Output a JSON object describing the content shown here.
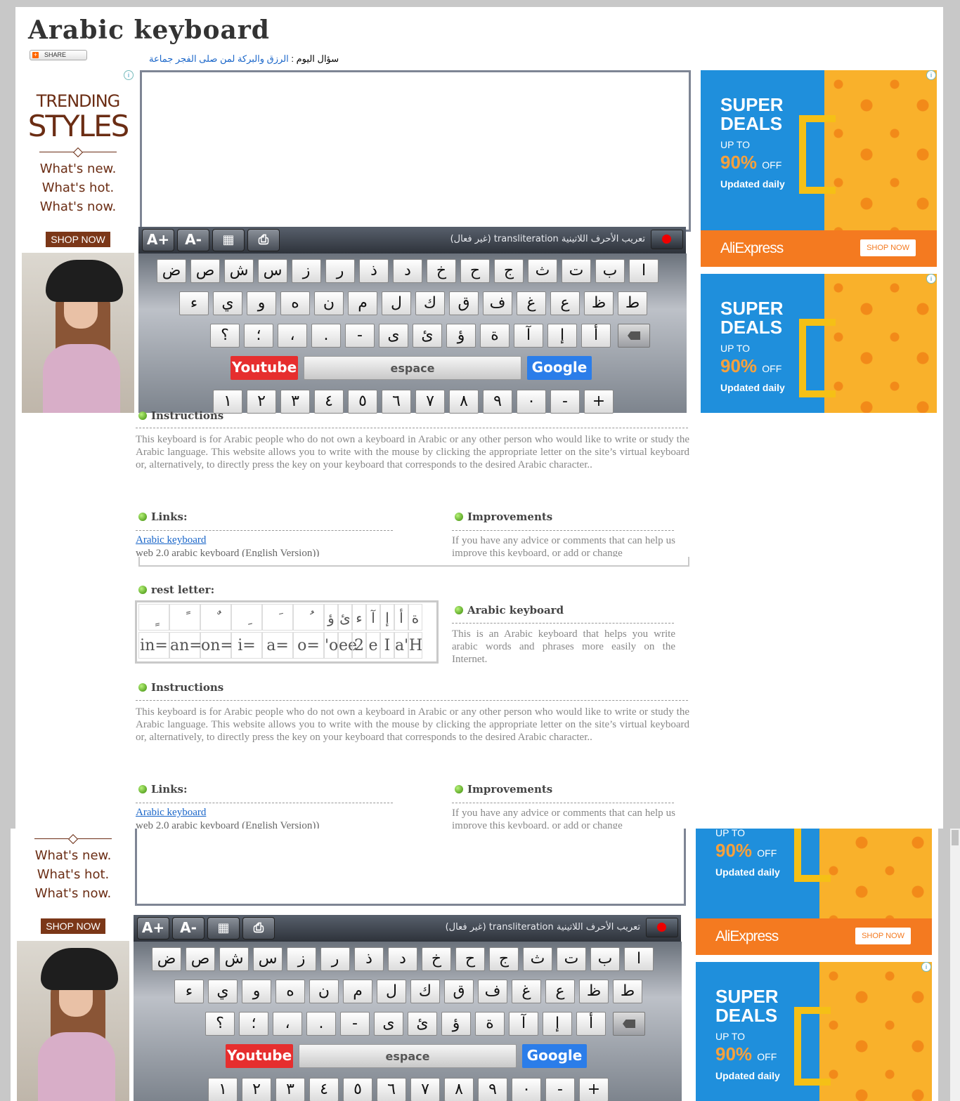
{
  "site": {
    "title": "Arabic keyboard",
    "share_label": "SHARE",
    "question_prefix": "سؤال اليوم :",
    "question_link": "الرزق والبركة لمن صلى الفجر جماعة"
  },
  "ad_left": {
    "line1": "TRENDING",
    "line2": "STYLES",
    "lines": [
      "What's new.",
      "What's hot.",
      "What's now."
    ],
    "shop": "SHOP NOW"
  },
  "ad_right": {
    "title": "SUPER DEALS",
    "upto": "UP TO",
    "percent": "90%",
    "off": "OFF",
    "updated": "Updated daily",
    "brand": "AliExpress",
    "shop": "SHOP NOW"
  },
  "toolbar": {
    "font_up": "A+",
    "font_down": "A-",
    "translit": "تعريب الأحرف اللاتينية transliteration (غير فعال)"
  },
  "keyboard": {
    "row1": [
      "ض",
      "ص",
      "ش",
      "س",
      "ز",
      "ر",
      "ذ",
      "د",
      "خ",
      "ح",
      "ج",
      "ث",
      "ت",
      "ب",
      "ا"
    ],
    "row2": [
      "ء",
      "ي",
      "و",
      "ه",
      "ن",
      "م",
      "ل",
      "ك",
      "ق",
      "ف",
      "غ",
      "ع",
      "ظ",
      "ط"
    ],
    "row3": [
      "؟",
      "؛",
      "،",
      ".",
      "-",
      "ى",
      "ئ",
      "ؤ",
      "ة",
      "آ",
      "إ",
      "أ"
    ],
    "youtube": "Youtube",
    "space": "espace",
    "google": "Google",
    "row5": [
      "١",
      "٢",
      "٣",
      "٤",
      "٥",
      "٦",
      "٧",
      "٨",
      "٩",
      "٠",
      "-",
      "+"
    ]
  },
  "content": {
    "instructions_title": "Instructions",
    "instructions_text": "This keyboard is for Arabic people who do not own a keyboard in Arabic or any other person who would like to write or study the Arabic language. This website allows you to write with the mouse by clicking the appropriate letter on the site’s virtual keyboard or, alternatively, to directly press the key on your keyboard that corresponds to the desired Arabic character..",
    "links_title": "Links:",
    "link1": "Arabic keyboard",
    "link2": "web 2.0 arabic keyboard (English Version))",
    "improvements_title": "Improvements",
    "improvements_text": "If you have any advice or comments that can help us improve this keyboard, or add or change",
    "rest_title": "rest letter:",
    "rest_top": [
      "ٍ",
      "ً",
      "ٌ",
      "ِ",
      "َ",
      "ُ",
      "ؤ",
      "ئ",
      "ء",
      "آ",
      "إ",
      "أ",
      "ة"
    ],
    "rest_bottom": [
      "in=",
      "an=",
      "on=",
      "i=",
      "a=",
      "o=",
      "'o",
      "ee",
      "2",
      "e",
      "I",
      "a'",
      "H"
    ],
    "arabic_kb_title": "Arabic keyboard",
    "arabic_kb_text": "This is an Arabic keyboard that helps you write arabic words and phrases more easily on the Internet."
  }
}
